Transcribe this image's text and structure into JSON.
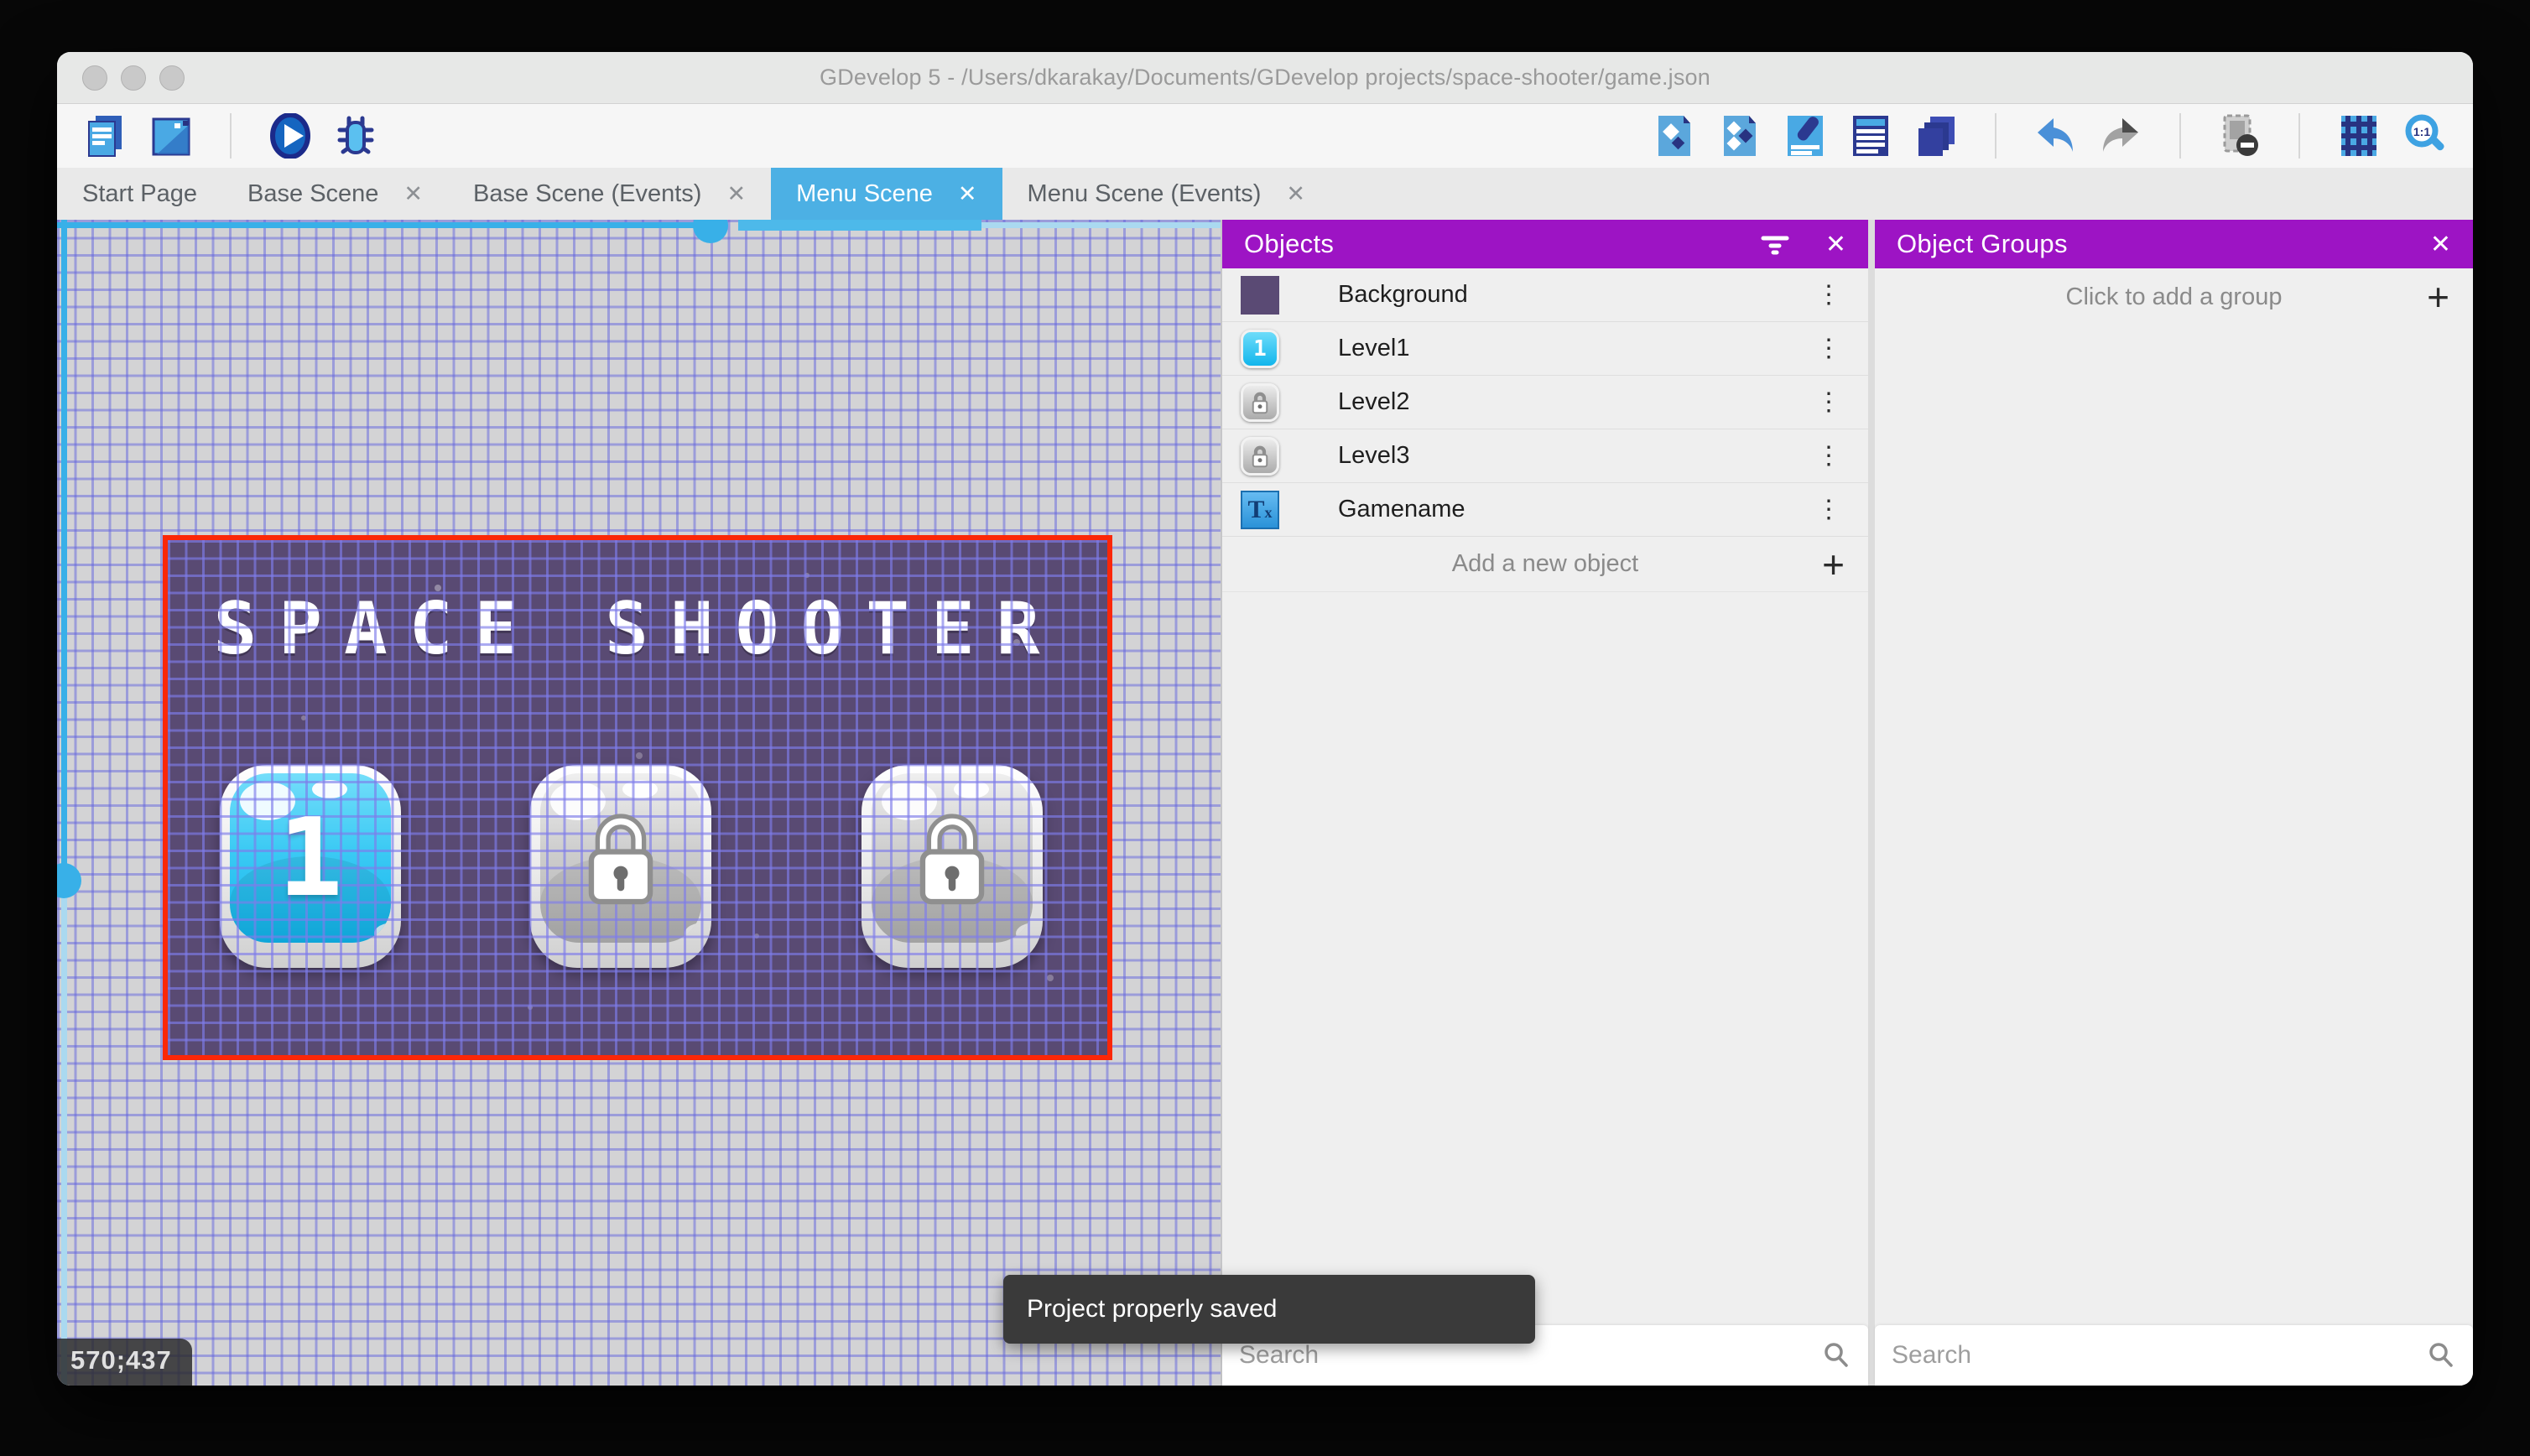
{
  "window": {
    "title": "GDevelop 5 - /Users/dkarakay/Documents/GDevelop projects/space-shooter/game.json"
  },
  "toolbar": {
    "left_icons": [
      "project-manager",
      "window",
      "preview",
      "debug"
    ],
    "right_icons": [
      "objects-editor",
      "object-groups-editor",
      "properties",
      "instances-list",
      "layers",
      "undo",
      "redo",
      "render-mask",
      "grid",
      "zoom-1-1"
    ],
    "zoom_icon_label": "1:1"
  },
  "tabs": [
    {
      "label": "Start Page",
      "active": false,
      "closable": false
    },
    {
      "label": "Base Scene",
      "active": false,
      "closable": true
    },
    {
      "label": "Base Scene (Events)",
      "active": false,
      "closable": true
    },
    {
      "label": "Menu Scene",
      "active": true,
      "closable": true
    },
    {
      "label": "Menu Scene (Events)",
      "active": false,
      "closable": true
    }
  ],
  "canvas": {
    "coordinates": "570;437"
  },
  "scene": {
    "title": "SPACE SHOOTER",
    "background_color": "#594a73",
    "selection_border_color": "#fb2708",
    "buttons": [
      {
        "label": "1",
        "locked": false
      },
      {
        "label": "",
        "locked": true
      },
      {
        "label": "",
        "locked": true
      }
    ]
  },
  "objects_panel": {
    "title": "Objects",
    "items": [
      {
        "name": "Background",
        "icon": "background-color-thumbnail"
      },
      {
        "name": "Level1",
        "icon": "blue-key-1-thumbnail",
        "badge": "1"
      },
      {
        "name": "Level2",
        "icon": "gray-lock-key-thumbnail"
      },
      {
        "name": "Level3",
        "icon": "gray-lock-key-thumbnail"
      },
      {
        "name": "Gamename",
        "icon": "text-object-thumbnail",
        "icon_text_main": "T",
        "icon_text_sub": "x"
      }
    ],
    "add_label": "Add a new object",
    "search_placeholder": "Search"
  },
  "groups_panel": {
    "title": "Object Groups",
    "add_label": "Click to add a group",
    "search_placeholder": "Search"
  },
  "toast": {
    "message": "Project properly saved"
  },
  "icons": {
    "close": "✕",
    "plus": "+",
    "menu": "⋮"
  },
  "colors": {
    "panel_header": "#9d14c4",
    "active_tab": "#4cb0e4",
    "selection": "#fb2708",
    "scene_background": "#594a73",
    "grid_line": "#6365de",
    "scrollbar": "#38b0e8",
    "toast_background": "#3a3a3a"
  }
}
